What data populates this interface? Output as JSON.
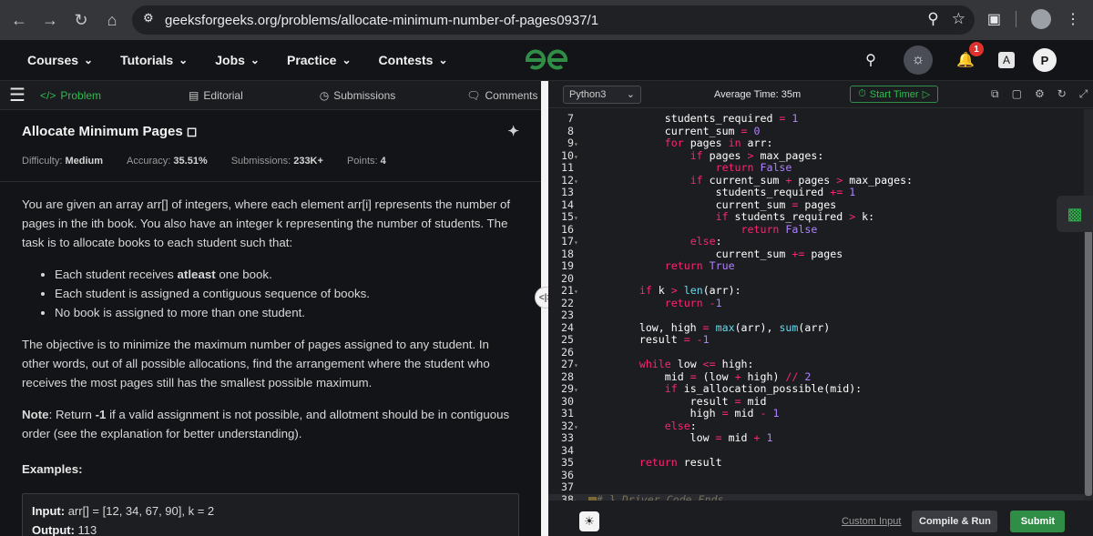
{
  "browser": {
    "url": "geeksforgeeks.org/problems/allocate-minimum-number-of-pages0937/1"
  },
  "header": {
    "menu": [
      "Courses",
      "Tutorials",
      "Jobs",
      "Practice",
      "Contests"
    ],
    "notification_count": "1",
    "avatar_letter": "P"
  },
  "left_tabs": {
    "problem": "Problem",
    "editorial": "Editorial",
    "submissions": "Submissions",
    "comments": "Comments"
  },
  "problem": {
    "title": "Allocate Minimum Pages",
    "difficulty_label": "Difficulty:",
    "difficulty": "Medium",
    "accuracy_label": "Accuracy:",
    "accuracy": "35.51%",
    "submissions_label": "Submissions:",
    "submissions": "233K+",
    "points_label": "Points:",
    "points": "4",
    "intro": "You are given an array arr[] of integers, where each element arr[i] represents the number of pages in the ith book. You also have an integer k representing the number of students. The task is to allocate books to each student such that:",
    "bullet1_pre": "Each student receives ",
    "bullet1_bold": "atleast",
    "bullet1_post": " one book.",
    "bullet2": "Each student is assigned a contiguous sequence of books.",
    "bullet3": "No book is assigned to more than one student.",
    "objective": "The objective is to minimize the maximum number of pages assigned to any student. In other words, out of all possible allocations, find the arrangement where the student who receives the most pages still has the smallest possible maximum.",
    "note_label": "Note",
    "note_pre": ": Return ",
    "note_bold": "-1",
    "note_post": " if a valid assignment is not possible, and allotment should be in contiguous order (see the explanation for better understanding).",
    "examples_heading": "Examples:",
    "example_input_label": "Input:",
    "example_input": " arr[] = [12, 34, 67, 90], k = 2",
    "example_output_label": "Output:",
    "example_output": " 113"
  },
  "editor": {
    "language": "Python3",
    "avg_time": "Average Time: 35m",
    "start_timer": "Start Timer",
    "custom_input": "Custom Input",
    "compile_run": "Compile & Run",
    "submit": "Submit"
  }
}
